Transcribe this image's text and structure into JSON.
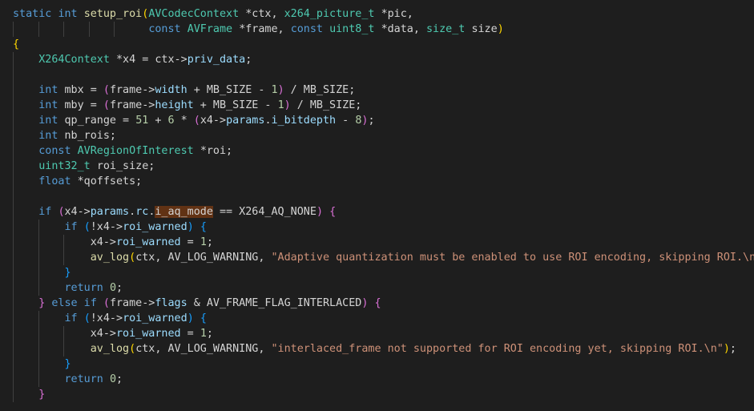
{
  "editor": {
    "language": "c",
    "theme": "dark",
    "highlighted_token": "i_aq_mode",
    "lines": [
      {
        "guides": 0,
        "tokens": [
          [
            "kw",
            "static "
          ],
          [
            "kw",
            "int "
          ],
          [
            "fn",
            "setup_roi"
          ],
          [
            "br1",
            "("
          ],
          [
            "ty",
            "AVCodecContext "
          ],
          [
            "id",
            "*ctx, "
          ],
          [
            "ty",
            "x264_picture_t "
          ],
          [
            "id",
            "*pic,"
          ]
        ]
      },
      {
        "guides": 5,
        "tokens": [
          [
            "id",
            "                     "
          ],
          [
            "kw",
            "const "
          ],
          [
            "ty",
            "AVFrame "
          ],
          [
            "id",
            "*frame, "
          ],
          [
            "kw",
            "const "
          ],
          [
            "ty",
            "uint8_t "
          ],
          [
            "id",
            "*data, "
          ],
          [
            "ty",
            "size_t "
          ],
          [
            "id",
            "size"
          ],
          [
            "br1",
            ")"
          ]
        ]
      },
      {
        "guides": 0,
        "tokens": [
          [
            "br1",
            "{"
          ]
        ]
      },
      {
        "guides": 1,
        "tokens": [
          [
            "id",
            "    "
          ],
          [
            "ty",
            "X264Context "
          ],
          [
            "id",
            "*x4 = ctx->"
          ],
          [
            "prop",
            "priv_data"
          ],
          [
            "id",
            ";"
          ]
        ]
      },
      {
        "guides": 1,
        "tokens": []
      },
      {
        "guides": 1,
        "tokens": [
          [
            "id",
            "    "
          ],
          [
            "kw",
            "int "
          ],
          [
            "id",
            "mbx = "
          ],
          [
            "br2",
            "("
          ],
          [
            "id",
            "frame->"
          ],
          [
            "prop",
            "width"
          ],
          [
            "id",
            " + MB_SIZE - "
          ],
          [
            "num",
            "1"
          ],
          [
            "br2",
            ")"
          ],
          [
            "id",
            " / MB_SIZE;"
          ]
        ]
      },
      {
        "guides": 1,
        "tokens": [
          [
            "id",
            "    "
          ],
          [
            "kw",
            "int "
          ],
          [
            "id",
            "mby = "
          ],
          [
            "br2",
            "("
          ],
          [
            "id",
            "frame->"
          ],
          [
            "prop",
            "height"
          ],
          [
            "id",
            " + MB_SIZE - "
          ],
          [
            "num",
            "1"
          ],
          [
            "br2",
            ")"
          ],
          [
            "id",
            " / MB_SIZE;"
          ]
        ]
      },
      {
        "guides": 1,
        "tokens": [
          [
            "id",
            "    "
          ],
          [
            "kw",
            "int "
          ],
          [
            "id",
            "qp_range = "
          ],
          [
            "num",
            "51"
          ],
          [
            "id",
            " + "
          ],
          [
            "num",
            "6"
          ],
          [
            "id",
            " * "
          ],
          [
            "br2",
            "("
          ],
          [
            "id",
            "x4->"
          ],
          [
            "prop",
            "params"
          ],
          [
            "id",
            "."
          ],
          [
            "prop",
            "i_bitdepth"
          ],
          [
            "id",
            " - "
          ],
          [
            "num",
            "8"
          ],
          [
            "br2",
            ")"
          ],
          [
            "id",
            ";"
          ]
        ]
      },
      {
        "guides": 1,
        "tokens": [
          [
            "id",
            "    "
          ],
          [
            "kw",
            "int "
          ],
          [
            "id",
            "nb_rois;"
          ]
        ]
      },
      {
        "guides": 1,
        "tokens": [
          [
            "id",
            "    "
          ],
          [
            "kw",
            "const "
          ],
          [
            "ty",
            "AVRegionOfInterest "
          ],
          [
            "id",
            "*roi;"
          ]
        ]
      },
      {
        "guides": 1,
        "tokens": [
          [
            "id",
            "    "
          ],
          [
            "ty",
            "uint32_t "
          ],
          [
            "id",
            "roi_size;"
          ]
        ]
      },
      {
        "guides": 1,
        "tokens": [
          [
            "id",
            "    "
          ],
          [
            "kw",
            "float "
          ],
          [
            "id",
            "*qoffsets;"
          ]
        ]
      },
      {
        "guides": 1,
        "tokens": []
      },
      {
        "guides": 1,
        "tokens": [
          [
            "id",
            "    "
          ],
          [
            "kw",
            "if "
          ],
          [
            "br2",
            "("
          ],
          [
            "id",
            "x4->"
          ],
          [
            "prop",
            "params"
          ],
          [
            "id",
            "."
          ],
          [
            "prop",
            "rc"
          ],
          [
            "id",
            "."
          ],
          [
            "hl",
            "i_aq_mode"
          ],
          [
            "id",
            " == X264_AQ_NONE"
          ],
          [
            "br2",
            ")"
          ],
          [
            "id",
            " "
          ],
          [
            "br2",
            "{"
          ]
        ]
      },
      {
        "guides": 2,
        "tokens": [
          [
            "id",
            "        "
          ],
          [
            "kw",
            "if "
          ],
          [
            "br3",
            "("
          ],
          [
            "id",
            "!x4->"
          ],
          [
            "prop",
            "roi_warned"
          ],
          [
            "br3",
            ")"
          ],
          [
            "id",
            " "
          ],
          [
            "br3",
            "{"
          ]
        ]
      },
      {
        "guides": 3,
        "tokens": [
          [
            "id",
            "            x4->"
          ],
          [
            "prop",
            "roi_warned"
          ],
          [
            "id",
            " = "
          ],
          [
            "num",
            "1"
          ],
          [
            "id",
            ";"
          ]
        ]
      },
      {
        "guides": 3,
        "tokens": [
          [
            "id",
            "            "
          ],
          [
            "fn",
            "av_log"
          ],
          [
            "br1",
            "("
          ],
          [
            "id",
            "ctx, AV_LOG_WARNING, "
          ],
          [
            "str",
            "\"Adaptive quantization must be enabled to use ROI encoding, skipping ROI.\\n\""
          ],
          [
            "br1",
            ")"
          ],
          [
            "id",
            ";"
          ]
        ]
      },
      {
        "guides": 2,
        "tokens": [
          [
            "id",
            "        "
          ],
          [
            "br3",
            "}"
          ]
        ]
      },
      {
        "guides": 2,
        "tokens": [
          [
            "id",
            "        "
          ],
          [
            "kw",
            "return "
          ],
          [
            "num",
            "0"
          ],
          [
            "id",
            ";"
          ]
        ]
      },
      {
        "guides": 1,
        "tokens": [
          [
            "id",
            "    "
          ],
          [
            "br2",
            "}"
          ],
          [
            "id",
            " "
          ],
          [
            "kw",
            "else if "
          ],
          [
            "br2",
            "("
          ],
          [
            "id",
            "frame->"
          ],
          [
            "prop",
            "flags"
          ],
          [
            "id",
            " & AV_FRAME_FLAG_INTERLACED"
          ],
          [
            "br2",
            ")"
          ],
          [
            "id",
            " "
          ],
          [
            "br2",
            "{"
          ]
        ]
      },
      {
        "guides": 2,
        "tokens": [
          [
            "id",
            "        "
          ],
          [
            "kw",
            "if "
          ],
          [
            "br3",
            "("
          ],
          [
            "id",
            "!x4->"
          ],
          [
            "prop",
            "roi_warned"
          ],
          [
            "br3",
            ")"
          ],
          [
            "id",
            " "
          ],
          [
            "br3",
            "{"
          ]
        ]
      },
      {
        "guides": 3,
        "tokens": [
          [
            "id",
            "            x4->"
          ],
          [
            "prop",
            "roi_warned"
          ],
          [
            "id",
            " = "
          ],
          [
            "num",
            "1"
          ],
          [
            "id",
            ";"
          ]
        ]
      },
      {
        "guides": 3,
        "tokens": [
          [
            "id",
            "            "
          ],
          [
            "fn",
            "av_log"
          ],
          [
            "br1",
            "("
          ],
          [
            "id",
            "ctx, AV_LOG_WARNING, "
          ],
          [
            "str",
            "\"interlaced_frame not supported for ROI encoding yet, skipping ROI.\\n\""
          ],
          [
            "br1",
            ")"
          ],
          [
            "id",
            ";"
          ]
        ]
      },
      {
        "guides": 2,
        "tokens": [
          [
            "id",
            "        "
          ],
          [
            "br3",
            "}"
          ]
        ]
      },
      {
        "guides": 2,
        "tokens": [
          [
            "id",
            "        "
          ],
          [
            "kw",
            "return "
          ],
          [
            "num",
            "0"
          ],
          [
            "id",
            ";"
          ]
        ]
      },
      {
        "guides": 1,
        "tokens": [
          [
            "id",
            "    "
          ],
          [
            "br2",
            "}"
          ]
        ]
      },
      {
        "guides": 0,
        "tokens": []
      }
    ]
  }
}
